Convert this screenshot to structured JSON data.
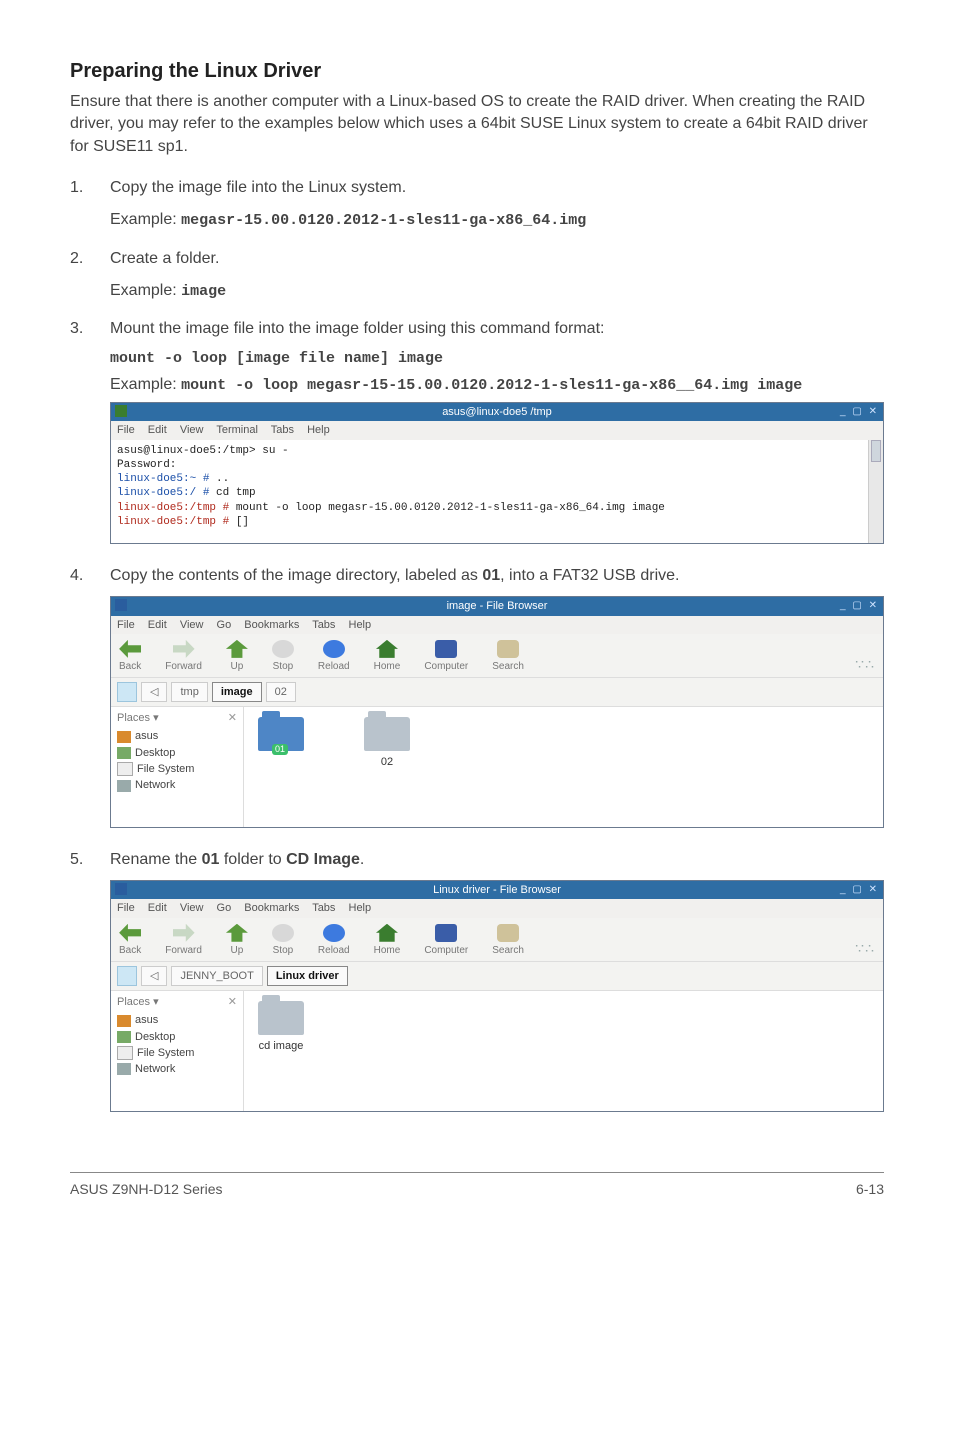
{
  "section": {
    "title": "Preparing the Linux Driver",
    "intro": "Ensure that there is another computer with a Linux-based OS to create the RAID driver. When creating the RAID driver, you may refer to the examples below which uses a 64bit SUSE Linux system to create a 64bit RAID driver for SUSE11 sp1."
  },
  "steps": {
    "s1": {
      "text": "Copy the image file into the Linux system.",
      "example_label": "Example:",
      "example_code": "megasr-15.00.0120.2012-1-sles11-ga-x86_64.img"
    },
    "s2": {
      "text": "Create a folder.",
      "example_label": "Example:",
      "example_code": "image"
    },
    "s3": {
      "text": "Mount the image file into the image folder using this command format:",
      "code1": "mount -o loop [image file name] image",
      "example_label": "Example:",
      "code2": "mount -o loop megasr-15-15.00.0120.2012-1-sles11-ga-x86__64.img image"
    },
    "s4": {
      "text_a": "Copy the contents of the image directory, labeled as ",
      "bold": "01",
      "text_b": ", into  a FAT32 USB drive."
    },
    "s5": {
      "text_a": "Rename the ",
      "bold1": "01",
      "text_b": " folder to ",
      "bold2": "CD Image",
      "text_c": "."
    }
  },
  "terminal": {
    "title": "asus@linux-doe5 /tmp",
    "menu": {
      "file": "File",
      "edit": "Edit",
      "view": "View",
      "terminal": "Terminal",
      "tabs": "Tabs",
      "help": "Help"
    },
    "lines": {
      "l1a": "asus@linux-doe5:/tmp> su -",
      "l2": "Password:",
      "l3a": "linux-doe5:~ #",
      "l3b": " ..",
      "l4a": "linux-doe5:/ #",
      "l4b": " cd tmp",
      "l5a": "linux-doe5:/tmp #",
      "l5b": " mount -o loop megasr-15.00.0120.2012-1-sles11-ga-x86_64.img image",
      "l6a": "linux-doe5:/tmp #",
      "l6b": " []"
    }
  },
  "fb1": {
    "title": "image - File Browser",
    "menu": {
      "file": "File",
      "edit": "Edit",
      "view": "View",
      "go": "Go",
      "bookmarks": "Bookmarks",
      "tabs": "Tabs",
      "help": "Help"
    },
    "toolbar": {
      "back": "Back",
      "forward": "Forward",
      "up": "Up",
      "stop": "Stop",
      "reload": "Reload",
      "home": "Home",
      "computer": "Computer",
      "search": "Search"
    },
    "path": {
      "c1": "tmp",
      "c2": "image",
      "c3": "02"
    },
    "places_header": "Places ▾",
    "places_x": "✕",
    "places": {
      "asus": "asus",
      "desktop": "Desktop",
      "fs": "File System",
      "net": "Network"
    },
    "items": {
      "i1_badge": "01",
      "i2": "02"
    }
  },
  "fb2": {
    "title": "Linux driver - File Browser",
    "menu": {
      "file": "File",
      "edit": "Edit",
      "view": "View",
      "go": "Go",
      "bookmarks": "Bookmarks",
      "tabs": "Tabs",
      "help": "Help"
    },
    "toolbar": {
      "back": "Back",
      "forward": "Forward",
      "up": "Up",
      "stop": "Stop",
      "reload": "Reload",
      "home": "Home",
      "computer": "Computer",
      "search": "Search"
    },
    "path": {
      "c1": "JENNY_BOOT",
      "c2": "Linux driver"
    },
    "places_header": "Places ▾",
    "places_x": "✕",
    "places": {
      "asus": "asus",
      "desktop": "Desktop",
      "fs": "File System",
      "net": "Network"
    },
    "items": {
      "i1": "cd image"
    }
  },
  "footer": {
    "left": "ASUS Z9NH-D12 Series",
    "right": "6-13"
  }
}
